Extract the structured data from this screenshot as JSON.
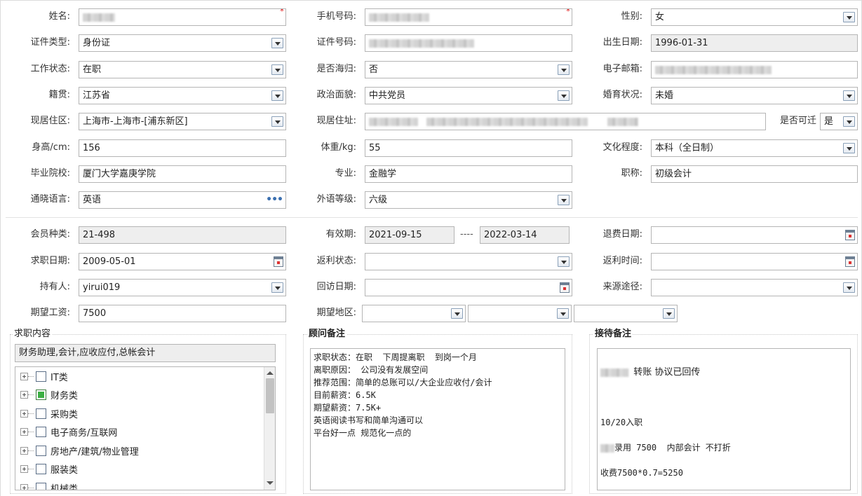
{
  "personal": {
    "name_label": "姓名:",
    "phone_label": "手机号码:",
    "gender_label": "性别:",
    "gender_value": "女",
    "id_type_label": "证件类型:",
    "id_type_value": "身份证",
    "id_number_label": "证件号码:",
    "birth_label": "出生日期:",
    "birth_value": "1996-01-31",
    "work_status_label": "工作状态:",
    "work_status_value": "在职",
    "overseas_label": "是否海归:",
    "overseas_value": "否",
    "email_label": "电子邮箱:",
    "native_label": "籍贯:",
    "native_value": "江苏省",
    "political_label": "政治面貌:",
    "political_value": "中共党员",
    "marital_label": "婚育状况:",
    "marital_value": "未婚",
    "district_label": "现居住区:",
    "district_value": "上海市-上海市-[浦东新区]",
    "address_label": "现居住址:",
    "relocate_label": "是否可迁",
    "relocate_value": "是",
    "height_label": "身高/cm:",
    "height_value": "156",
    "weight_label": "体重/kg:",
    "weight_value": "55",
    "education_label": "文化程度:",
    "education_value": "本科（全日制）",
    "school_label": "毕业院校:",
    "school_value": "厦门大学嘉庚学院",
    "major_label": "专业:",
    "major_value": "金融学",
    "title_label": "职称:",
    "title_value": "初级会计",
    "language_label": "通晓语言:",
    "language_value": "英语",
    "language_level_label": "外语等级:",
    "language_level_value": "六级",
    "required_mark": "*"
  },
  "membership": {
    "member_type_label": "会员种类:",
    "member_type_value": "21-498",
    "valid_label": "有效期:",
    "valid_from": "2021-09-15",
    "valid_sep": "----",
    "valid_to": "2022-03-14",
    "refund_date_label": "退费日期:",
    "job_date_label": "求职日期:",
    "job_date_value": "2009-05-01",
    "rebate_status_label": "返利状态:",
    "rebate_time_label": "返利时间:",
    "holder_label": "持有人:",
    "holder_value": "yirui019",
    "visit_date_label": "回访日期:",
    "source_label": "来源途径:",
    "salary_label": "期望工资:",
    "salary_value": "7500",
    "region_label": "期望地区:"
  },
  "job_content": {
    "title": "求职内容",
    "summary": "财务助理,会计,应收应付,总帐会计",
    "tree": [
      {
        "label": "IT类",
        "checked": false
      },
      {
        "label": "财务类",
        "checked": true
      },
      {
        "label": "采购类",
        "checked": false
      },
      {
        "label": "电子商务/互联网",
        "checked": false
      },
      {
        "label": "房地产/建筑/物业管理",
        "checked": false
      },
      {
        "label": "服装类",
        "checked": false
      },
      {
        "label": "机械类",
        "checked": false
      }
    ]
  },
  "advisor_notes": {
    "title": "顾问备注",
    "text": "求职状态：在职  下周提离职  到岗一个月\n离职原因： 公司没有发展空间\n推荐范围：简单的总账可以/大企业应收付/会计\n目前薪资：6.5K\n期望薪资：7.5K+\n英语阅读书写和简单沟通可以\n平台好一点 规范化一点的"
  },
  "reception_notes": {
    "title": "接待备注",
    "line1": "转账 协议已回传",
    "line2": "10/20入职",
    "line3": "录用 7500  内部会计 不打折",
    "line4": "收费7500*0.7=5250"
  }
}
